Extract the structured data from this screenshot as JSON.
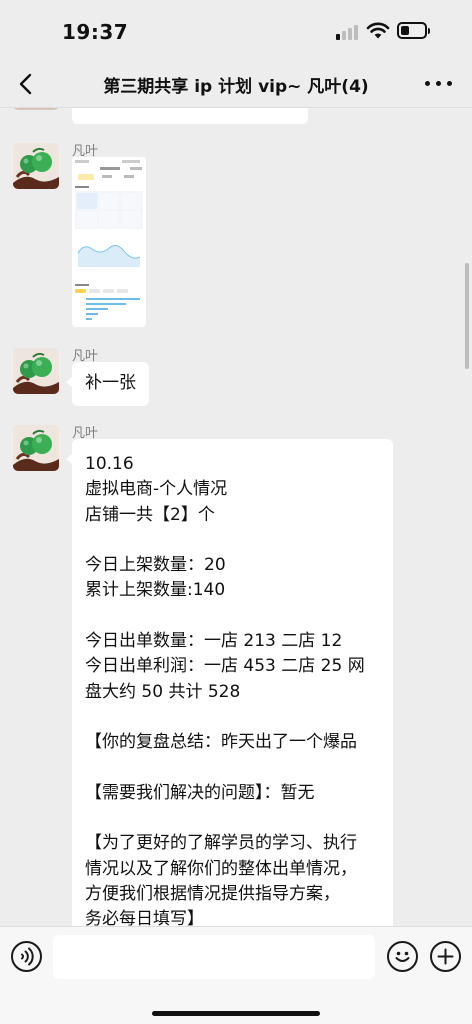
{
  "status_bar": {
    "time": "19:37",
    "signal_bars_active": 1,
    "battery_level": 0.3
  },
  "nav": {
    "title": "第三期共享 ip 计划 vip~ 凡叶(4)",
    "back_icon": "chevron-left-icon",
    "more_icon": "ellipsis-icon"
  },
  "messages": [
    {
      "type": "image",
      "sender": "凡叶",
      "avatar_icon": "jade-ornament-avatar"
    },
    {
      "type": "text",
      "sender": "凡叶",
      "text": "补一张"
    },
    {
      "type": "text",
      "sender": "凡叶",
      "text": "10.16\n虚拟电商-个人情况\n店铺一共【2】个\n\n今日上架数量：20\n累计上架数量:140\n\n今日出单数量：一店 213 二店 12\n今日出单利润：一店 453 二店 25 网\n盘大约 50 共计 528\n\n【你的复盘总结：昨天出了一个爆品\n\n【需要我们解决的问题】：暂无\n\n【为了更好的了解学员的学习、执行\n情况以及了解你们的整体出单情况，\n方便我们根据情况提供指导方案，\n务必每日填写】"
    }
  ],
  "input_bar": {
    "placeholder": "",
    "voice_icon": "voice-icon",
    "emoji_icon": "emoji-icon",
    "plus_icon": "plus-icon"
  }
}
